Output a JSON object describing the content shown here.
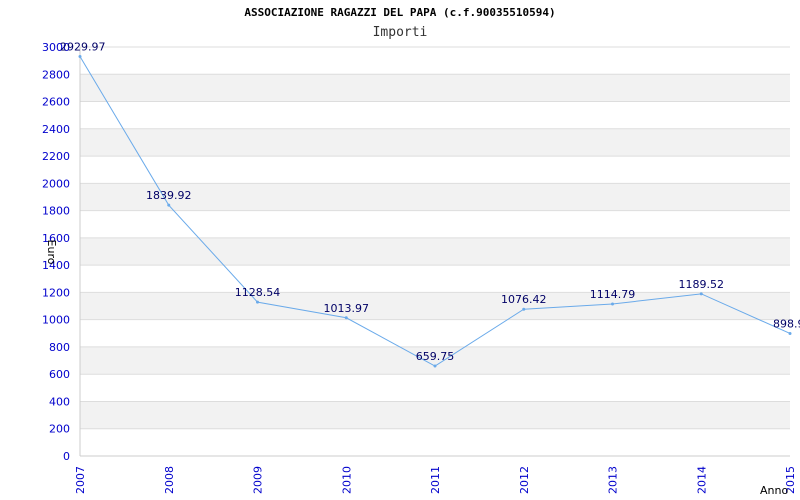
{
  "header": {
    "title": "ASSOCIAZIONE RAGAZZI DEL PAPA (c.f.90035510594)",
    "subtitle": "Importi"
  },
  "chart_data": {
    "type": "line",
    "title": "ASSOCIAZIONE RAGAZZI DEL PAPA (c.f.90035510594)",
    "subtitle": "Importi",
    "xlabel": "Anno",
    "ylabel": "Euro",
    "categories": [
      "2007",
      "2008",
      "2009",
      "2010",
      "2011",
      "2012",
      "2013",
      "2014",
      "2015"
    ],
    "series": [
      {
        "values": [
          2929.97,
          1839.92,
          1128.54,
          1013.97,
          659.75,
          1076.42,
          1114.79,
          1189.52,
          898.9
        ],
        "labels": [
          "2929.97",
          "1839.92",
          "1128.54",
          "1013.97",
          "659.75",
          "1076.42",
          "1114.79",
          "1189.52",
          "898.9"
        ]
      }
    ],
    "ylim": [
      0,
      3000
    ],
    "yticks": [
      0,
      200,
      400,
      600,
      800,
      1000,
      1200,
      1400,
      1600,
      1800,
      2000,
      2200,
      2400,
      2600,
      2800,
      3000
    ],
    "grid": true,
    "colors": {
      "line": "#6aaaea",
      "band": "#f2f2f2",
      "grid": "#dddddd",
      "axis_text": "#0000cc",
      "data_label": "#000066"
    }
  }
}
